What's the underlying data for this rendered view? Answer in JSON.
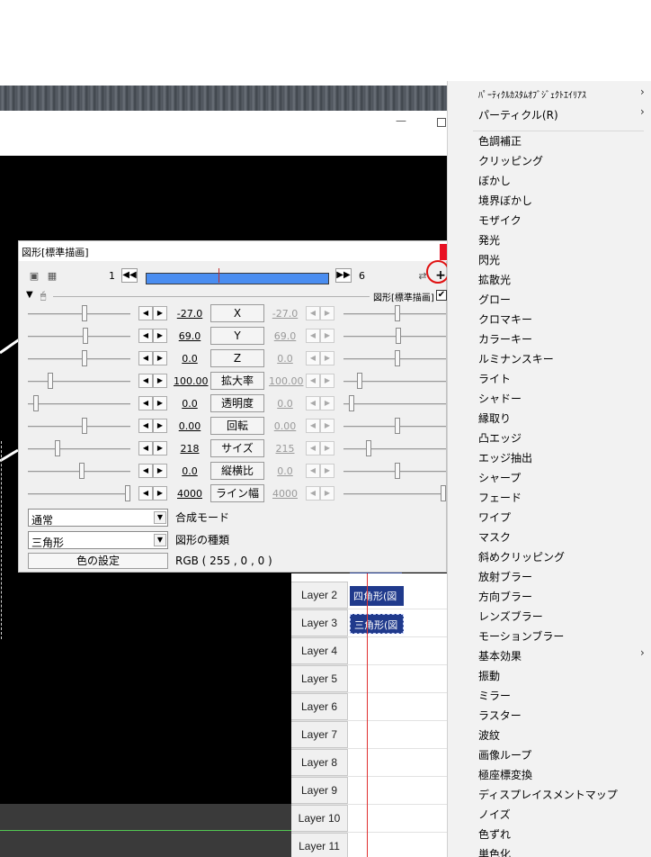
{
  "dialog": {
    "title": "図形[標準描画]",
    "frame_start": "1",
    "frame_end": "6",
    "add_filter_label": "+",
    "section_label": "図形[標準描画]",
    "section_checkbox": "✔",
    "params": [
      {
        "name": "X",
        "value": "-27.0",
        "end_value": "-27.0"
      },
      {
        "name": "Y",
        "value": "69.0",
        "end_value": "69.0"
      },
      {
        "name": "Z",
        "value": "0.0",
        "end_value": "0.0"
      },
      {
        "name": "拡大率",
        "value": "100.00",
        "end_value": "100.00"
      },
      {
        "name": "透明度",
        "value": "0.0",
        "end_value": "0.0"
      },
      {
        "name": "回転",
        "value": "0.00",
        "end_value": "0.00"
      },
      {
        "name": "サイズ",
        "value": "218",
        "end_value": "215"
      },
      {
        "name": "縦横比",
        "value": "0.0",
        "end_value": "0.0"
      },
      {
        "name": "ライン幅",
        "value": "4000",
        "end_value": "4000"
      }
    ],
    "blend_mode": {
      "value": "通常",
      "label": "合成モード"
    },
    "shape_type": {
      "value": "三角形",
      "label": "図形の種類"
    },
    "color_button": "色の設定",
    "rgb_text": "RGB ( 255 , 0 , 0 )"
  },
  "timeline": {
    "layers": [
      {
        "label": "Layer 2",
        "clip": "四角形(図"
      },
      {
        "label": "Layer 3",
        "clip": "三角形(図"
      },
      {
        "label": "Layer 4",
        "clip": ""
      },
      {
        "label": "Layer 5",
        "clip": ""
      },
      {
        "label": "Layer 6",
        "clip": ""
      },
      {
        "label": "Layer 7",
        "clip": ""
      },
      {
        "label": "Layer 8",
        "clip": ""
      },
      {
        "label": "Layer 9",
        "clip": ""
      },
      {
        "label": "Layer 10",
        "clip": ""
      },
      {
        "label": "Layer 11",
        "clip": ""
      }
    ]
  },
  "menu": {
    "items": [
      {
        "label": "ﾊﾟｰﾃｨｸﾙｶｽﾀﾑｵﾌﾞｼﾞｪｸﾄｴｲﾘｱｽ",
        "submenu": true
      },
      {
        "label": "パーティクル(R)",
        "submenu": true
      },
      {
        "label": "色調補正",
        "submenu": false
      },
      {
        "label": "クリッピング",
        "submenu": false
      },
      {
        "label": "ぼかし",
        "submenu": false
      },
      {
        "label": "境界ぼかし",
        "submenu": false
      },
      {
        "label": "モザイク",
        "submenu": false
      },
      {
        "label": "発光",
        "submenu": false
      },
      {
        "label": "閃光",
        "submenu": false
      },
      {
        "label": "拡散光",
        "submenu": false
      },
      {
        "label": "グロー",
        "submenu": false
      },
      {
        "label": "クロマキー",
        "submenu": false
      },
      {
        "label": "カラーキー",
        "submenu": false
      },
      {
        "label": "ルミナンスキー",
        "submenu": false
      },
      {
        "label": "ライト",
        "submenu": false
      },
      {
        "label": "シャドー",
        "submenu": false
      },
      {
        "label": "縁取り",
        "submenu": false
      },
      {
        "label": "凸エッジ",
        "submenu": false
      },
      {
        "label": "エッジ抽出",
        "submenu": false
      },
      {
        "label": "シャープ",
        "submenu": false
      },
      {
        "label": "フェード",
        "submenu": false
      },
      {
        "label": "ワイプ",
        "submenu": false
      },
      {
        "label": "マスク",
        "submenu": false
      },
      {
        "label": "斜めクリッピング",
        "submenu": false
      },
      {
        "label": "放射ブラー",
        "submenu": false
      },
      {
        "label": "方向ブラー",
        "submenu": false
      },
      {
        "label": "レンズブラー",
        "submenu": false
      },
      {
        "label": "モーションブラー",
        "submenu": false
      },
      {
        "label": "基本効果",
        "submenu": true
      },
      {
        "label": "振動",
        "submenu": false
      },
      {
        "label": "ミラー",
        "submenu": false
      },
      {
        "label": "ラスター",
        "submenu": false
      },
      {
        "label": "波紋",
        "submenu": false
      },
      {
        "label": "画像ループ",
        "submenu": false
      },
      {
        "label": "極座標変換",
        "submenu": false
      },
      {
        "label": "ディスプレイスメントマップ",
        "submenu": false
      },
      {
        "label": "ノイズ",
        "submenu": false
      },
      {
        "label": "色ずれ",
        "submenu": false
      },
      {
        "label": "単色化",
        "submenu": false
      }
    ],
    "submenu_arrow": "›"
  },
  "window": {
    "minimize_glyph": "—"
  },
  "colors": {
    "accent_blue": "#4a8df0",
    "clip_blue": "#203a8c",
    "highlight_red": "#e01010"
  }
}
